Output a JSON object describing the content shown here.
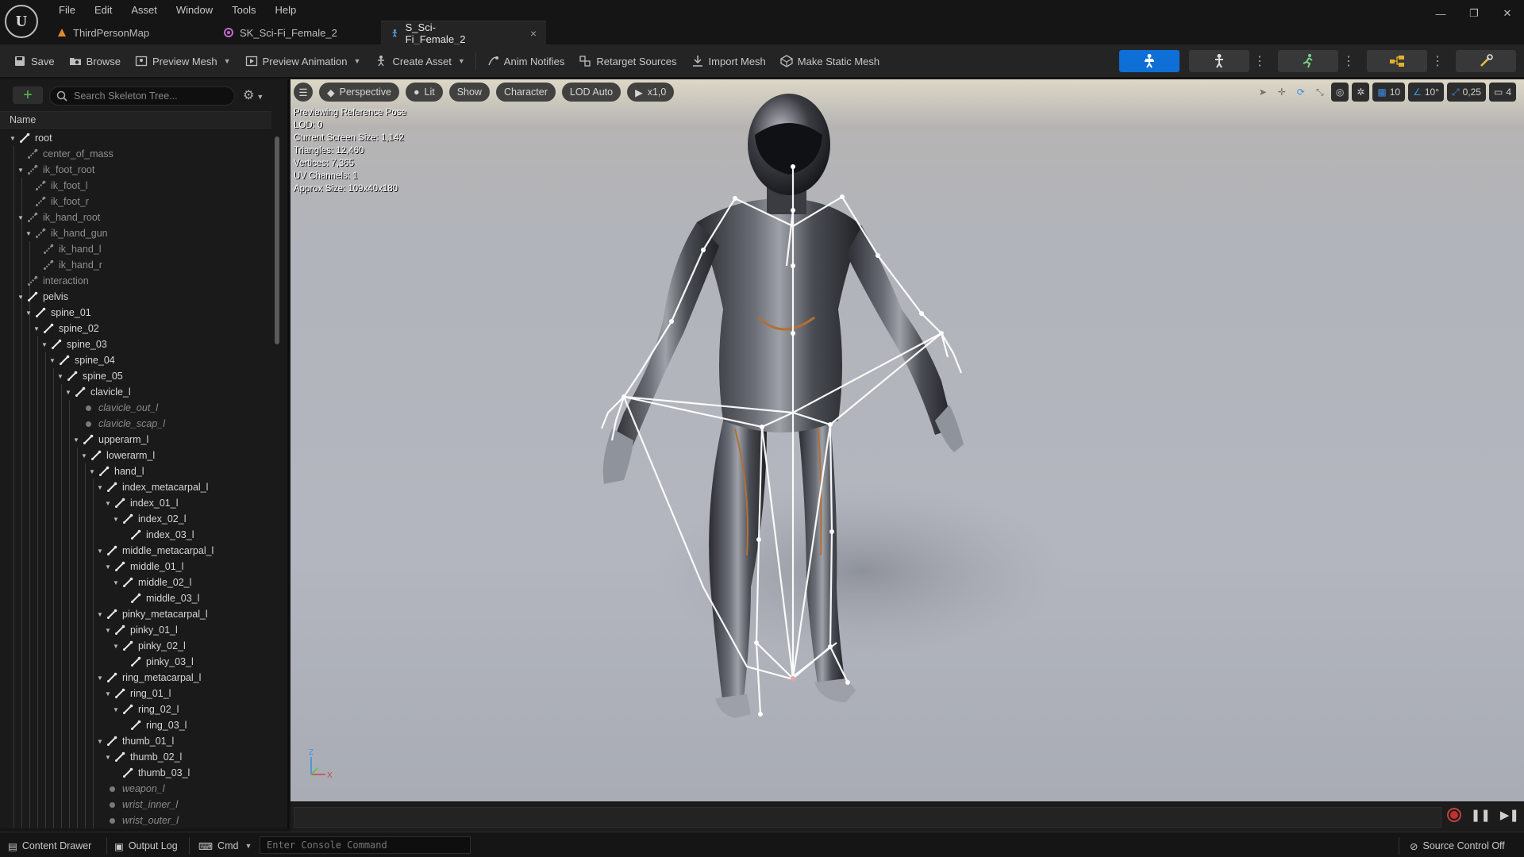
{
  "menu": [
    "File",
    "Edit",
    "Asset",
    "Window",
    "Tools",
    "Help"
  ],
  "tabs": [
    {
      "label": "ThirdPersonMap",
      "icon": "map-icon"
    },
    {
      "label": "SK_Sci-Fi_Female_2",
      "icon": "skeletal-mesh-icon"
    },
    {
      "label": "S_Sci-Fi_Female_2",
      "icon": "skeleton-icon",
      "active": true,
      "close": "×"
    }
  ],
  "window_controls": {
    "minimize": "—",
    "maximize": "❐",
    "close": "✕"
  },
  "toolbar": {
    "save": "Save",
    "browse": "Browse",
    "preview_mesh": "Preview Mesh",
    "preview_animation": "Preview Animation",
    "create_asset": "Create Asset",
    "anim_notifies": "Anim Notifies",
    "retarget_sources": "Retarget Sources",
    "import_mesh": "Import Mesh",
    "make_static_mesh": "Make Static Mesh"
  },
  "skeleton_tree": {
    "search_placeholder": "Search Skeleton Tree...",
    "column_name": "Name",
    "rows": [
      {
        "label": "root",
        "depth": 0,
        "kind": "bone",
        "expanded": true
      },
      {
        "label": "center_of_mass",
        "depth": 1,
        "kind": "virtual"
      },
      {
        "label": "ik_foot_root",
        "depth": 1,
        "kind": "virtual",
        "expanded": true
      },
      {
        "label": "ik_foot_l",
        "depth": 2,
        "kind": "virtual"
      },
      {
        "label": "ik_foot_r",
        "depth": 2,
        "kind": "virtual"
      },
      {
        "label": "ik_hand_root",
        "depth": 1,
        "kind": "virtual",
        "expanded": true
      },
      {
        "label": "ik_hand_gun",
        "depth": 2,
        "kind": "virtual",
        "expanded": true
      },
      {
        "label": "ik_hand_l",
        "depth": 3,
        "kind": "virtual"
      },
      {
        "label": "ik_hand_r",
        "depth": 3,
        "kind": "virtual"
      },
      {
        "label": "interaction",
        "depth": 1,
        "kind": "virtual"
      },
      {
        "label": "pelvis",
        "depth": 1,
        "kind": "bone",
        "expanded": true
      },
      {
        "label": "spine_01",
        "depth": 2,
        "kind": "bone",
        "expanded": true
      },
      {
        "label": "spine_02",
        "depth": 3,
        "kind": "bone",
        "expanded": true
      },
      {
        "label": "spine_03",
        "depth": 4,
        "kind": "bone",
        "expanded": true
      },
      {
        "label": "spine_04",
        "depth": 5,
        "kind": "bone",
        "expanded": true
      },
      {
        "label": "spine_05",
        "depth": 6,
        "kind": "bone",
        "expanded": true
      },
      {
        "label": "clavicle_l",
        "depth": 7,
        "kind": "bone",
        "expanded": true
      },
      {
        "label": "clavicle_out_l",
        "depth": 8,
        "kind": "socket"
      },
      {
        "label": "clavicle_scap_l",
        "depth": 8,
        "kind": "socket"
      },
      {
        "label": "upperarm_l",
        "depth": 8,
        "kind": "bone",
        "expanded": true
      },
      {
        "label": "lowerarm_l",
        "depth": 9,
        "kind": "bone",
        "expanded": true
      },
      {
        "label": "hand_l",
        "depth": 10,
        "kind": "bone",
        "expanded": true
      },
      {
        "label": "index_metacarpal_l",
        "depth": 11,
        "kind": "bone",
        "expanded": true
      },
      {
        "label": "index_01_l",
        "depth": 12,
        "kind": "bone",
        "expanded": true
      },
      {
        "label": "index_02_l",
        "depth": 13,
        "kind": "bone",
        "expanded": true
      },
      {
        "label": "index_03_l",
        "depth": 14,
        "kind": "bone"
      },
      {
        "label": "middle_metacarpal_l",
        "depth": 11,
        "kind": "bone",
        "expanded": true
      },
      {
        "label": "middle_01_l",
        "depth": 12,
        "kind": "bone",
        "expanded": true
      },
      {
        "label": "middle_02_l",
        "depth": 13,
        "kind": "bone",
        "expanded": true
      },
      {
        "label": "middle_03_l",
        "depth": 14,
        "kind": "bone"
      },
      {
        "label": "pinky_metacarpal_l",
        "depth": 11,
        "kind": "bone",
        "expanded": true
      },
      {
        "label": "pinky_01_l",
        "depth": 12,
        "kind": "bone",
        "expanded": true
      },
      {
        "label": "pinky_02_l",
        "depth": 13,
        "kind": "bone",
        "expanded": true
      },
      {
        "label": "pinky_03_l",
        "depth": 14,
        "kind": "bone"
      },
      {
        "label": "ring_metacarpal_l",
        "depth": 11,
        "kind": "bone",
        "expanded": true
      },
      {
        "label": "ring_01_l",
        "depth": 12,
        "kind": "bone",
        "expanded": true
      },
      {
        "label": "ring_02_l",
        "depth": 13,
        "kind": "bone",
        "expanded": true
      },
      {
        "label": "ring_03_l",
        "depth": 14,
        "kind": "bone"
      },
      {
        "label": "thumb_01_l",
        "depth": 11,
        "kind": "bone",
        "expanded": true
      },
      {
        "label": "thumb_02_l",
        "depth": 12,
        "kind": "bone",
        "expanded": true
      },
      {
        "label": "thumb_03_l",
        "depth": 13,
        "kind": "bone"
      },
      {
        "label": "weapon_l",
        "depth": 11,
        "kind": "socket"
      },
      {
        "label": "wrist_inner_l",
        "depth": 11,
        "kind": "socket"
      },
      {
        "label": "wrist_outer_l",
        "depth": 11,
        "kind": "socket"
      }
    ]
  },
  "viewport": {
    "toolbar": {
      "menu_icon": "hamburger-icon",
      "perspective": "Perspective",
      "lit": "Lit",
      "show": "Show",
      "character": "Character",
      "lod": "LOD Auto",
      "playback": "x1,0"
    },
    "right_toolbar": {
      "grid_size": "10",
      "rotation_snap": "10°",
      "scale_snap": "0,25",
      "camera_speed": "4"
    },
    "stats": [
      "Previewing Reference Pose",
      "LOD: 0",
      "Current Screen Size: 1,142",
      "Triangles: 12,460",
      "Vertices: 7,365",
      "UV Channels: 1",
      "Approx Size: 109x40x180"
    ],
    "axis_labels": {
      "z": "Z",
      "x": "X"
    }
  },
  "statusbar": {
    "content_drawer": "Content Drawer",
    "output_log": "Output Log",
    "cmd": "Cmd",
    "console_placeholder": "Enter Console Command",
    "source_control": "Source Control Off"
  },
  "colors": {
    "accent": "#0e6fd6",
    "add": "#56c14b",
    "record": "#c03030",
    "bone_lines": "#ffffff"
  }
}
